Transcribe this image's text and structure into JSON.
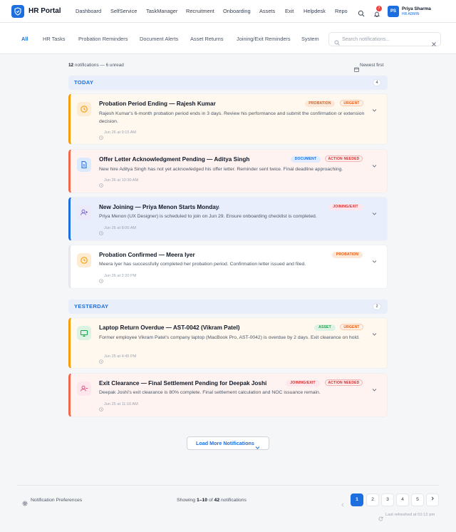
{
  "header": {
    "brand": "HR Portal",
    "nav": [
      "Dashboard",
      "SelfService",
      "TaskManager",
      "Recruitment",
      "Onboarding",
      "Assets",
      "Exit",
      "Helpdesk",
      "Repo"
    ],
    "notification_count": "7",
    "user_initials": "PS",
    "user_name": "Priya Sharma",
    "user_role": "HR ADMIN"
  },
  "filters": {
    "tabs": [
      "All",
      "HR Tasks",
      "Probation Reminders",
      "Document Alerts",
      "Asset Returns",
      "Joining/Exit Reminders",
      "System"
    ],
    "active": "All",
    "search_placeholder": "Search notifications..."
  },
  "summary": {
    "total": "12",
    "rest": "notifications — 6 unread",
    "sort": "Newest first"
  },
  "groups": [
    {
      "label": "TODAY",
      "count": "4"
    },
    {
      "label": "YESTERDAY",
      "count": "2"
    }
  ],
  "notifications": [
    {
      "title": "Probation Period Ending — Rajesh Kumar",
      "desc": "Rajesh Kumar's 6-month probation period ends in 3 days. Review his performance and submit the confirmation or extension decision.",
      "time": "Jun 26 at 9:15 AM",
      "tags": [
        "PROBATION",
        "URGENT"
      ],
      "icon": "clock-icon"
    },
    {
      "title": "Offer Letter Acknowledgment Pending — Aditya Singh",
      "desc": "New hire Aditya Singh has not yet acknowledged his offer letter. Reminder sent twice. Final deadline approaching.",
      "time": "Jun 26 at 10:30 AM",
      "tags": [
        "DOCUMENT",
        "ACTION NEEDED"
      ],
      "icon": "document-icon"
    },
    {
      "title": "New Joining — Priya Menon Starts Monday",
      "desc": "Priya Menon (UX Designer) is scheduled to join on Jun 29. Ensure onboarding checklist is completed.",
      "time": "Jun 26 at 8:00 AM",
      "tags": [
        "JOINING/EXIT"
      ],
      "icon": "user-plus-icon"
    },
    {
      "title": "Probation Confirmed — Meera Iyer",
      "desc": "Meera Iyer has successfully completed her probation period. Confirmation letter issued and filed.",
      "time": "Jun 26 at 2:20 PM",
      "tags": [
        "PROBATION"
      ],
      "icon": "clock-icon"
    },
    {
      "title": "Laptop Return Overdue — AST-0042 (Vikram Patel)",
      "desc": "Former employee Vikram Patel's company laptop (MacBook Pro, AST-0042) is overdue by 2 days. Exit clearance on hold.",
      "time": "Jun 25 at 4:45 PM",
      "tags": [
        "ASSET",
        "URGENT"
      ],
      "icon": "monitor-icon"
    },
    {
      "title": "Exit Clearance — Final Settlement Pending for Deepak Joshi",
      "desc": "Deepak Joshi's exit clearance is 80% complete. Final settlement calculation and NOC issuance remain.",
      "time": "Jun 25 at 11:10 AM",
      "tags": [
        "JOINING/EXIT",
        "ACTION NEEDED"
      ],
      "icon": "user-minus-icon"
    }
  ],
  "load_more": "Load More Notifications",
  "footer": {
    "preferences": "Notification Preferences",
    "showing_prefix": "Showing",
    "showing_range": "1–10",
    "showing_of": "of",
    "showing_total": "42",
    "showing_suffix": "notifications",
    "pages": [
      "1",
      "2",
      "3",
      "4",
      "5"
    ],
    "current_page": "1",
    "refreshed": "Last refreshed at 01:12 pm"
  },
  "colors": {
    "accent": "#1d6fe0",
    "urgent": "#ea580c",
    "danger": "#dc2626",
    "info": "#1d6fe0",
    "success": "#16a34a"
  }
}
